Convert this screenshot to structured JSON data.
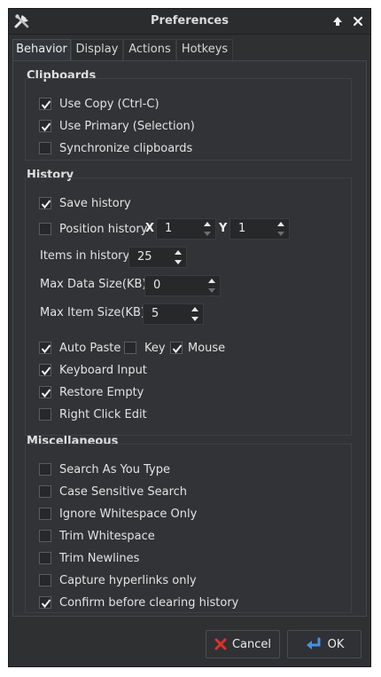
{
  "window": {
    "title": "Preferences"
  },
  "tabs": [
    "Behavior",
    "Display",
    "Actions",
    "Hotkeys"
  ],
  "clipboards": {
    "title": "Clipboards",
    "items": [
      {
        "label": "Use Copy (Ctrl-C)",
        "checked": true
      },
      {
        "label": "Use Primary (Selection)",
        "checked": true
      },
      {
        "label": "Synchronize clipboards",
        "checked": false
      }
    ]
  },
  "history": {
    "title": "History",
    "save_history": {
      "label": "Save history",
      "checked": true
    },
    "position_history": {
      "label": "Position history",
      "checked": false,
      "x_label": "X",
      "x_value": "1",
      "y_label": "Y",
      "y_value": "1"
    },
    "items_in_history": {
      "label": "Items in history",
      "value": "25"
    },
    "max_data_size": {
      "label": "Max Data Size(KB)",
      "value": "0"
    },
    "max_item_size": {
      "label": "Max Item Size(KB)",
      "value": "5"
    },
    "auto_paste": {
      "label": "Auto Paste",
      "checked": true
    },
    "key": {
      "label": "Key",
      "checked": false
    },
    "mouse": {
      "label": "Mouse",
      "checked": true
    },
    "keyboard_input": {
      "label": "Keyboard Input",
      "checked": true
    },
    "restore_empty": {
      "label": "Restore Empty",
      "checked": true
    },
    "right_click_edit": {
      "label": "Right Click Edit",
      "checked": false
    }
  },
  "misc": {
    "title": "Miscellaneous",
    "items": [
      {
        "label": "Search As You Type",
        "checked": false
      },
      {
        "label": "Case Sensitive Search",
        "checked": false
      },
      {
        "label": "Ignore Whitespace Only",
        "checked": false
      },
      {
        "label": "Trim Whitespace",
        "checked": false
      },
      {
        "label": "Trim Newlines",
        "checked": false
      },
      {
        "label": "Capture hyperlinks only",
        "checked": false
      },
      {
        "label": "Confirm before clearing history",
        "checked": true
      }
    ]
  },
  "buttons": {
    "cancel": "Cancel",
    "ok": "OK"
  },
  "icons": {
    "cancel": "red-x-icon",
    "ok": "blue-return-arrow-icon",
    "app": "tools-icon"
  },
  "colors": {
    "window_bg": "#2e3032",
    "cancel_icon": "#e0302a",
    "ok_icon": "#4a90e2"
  }
}
